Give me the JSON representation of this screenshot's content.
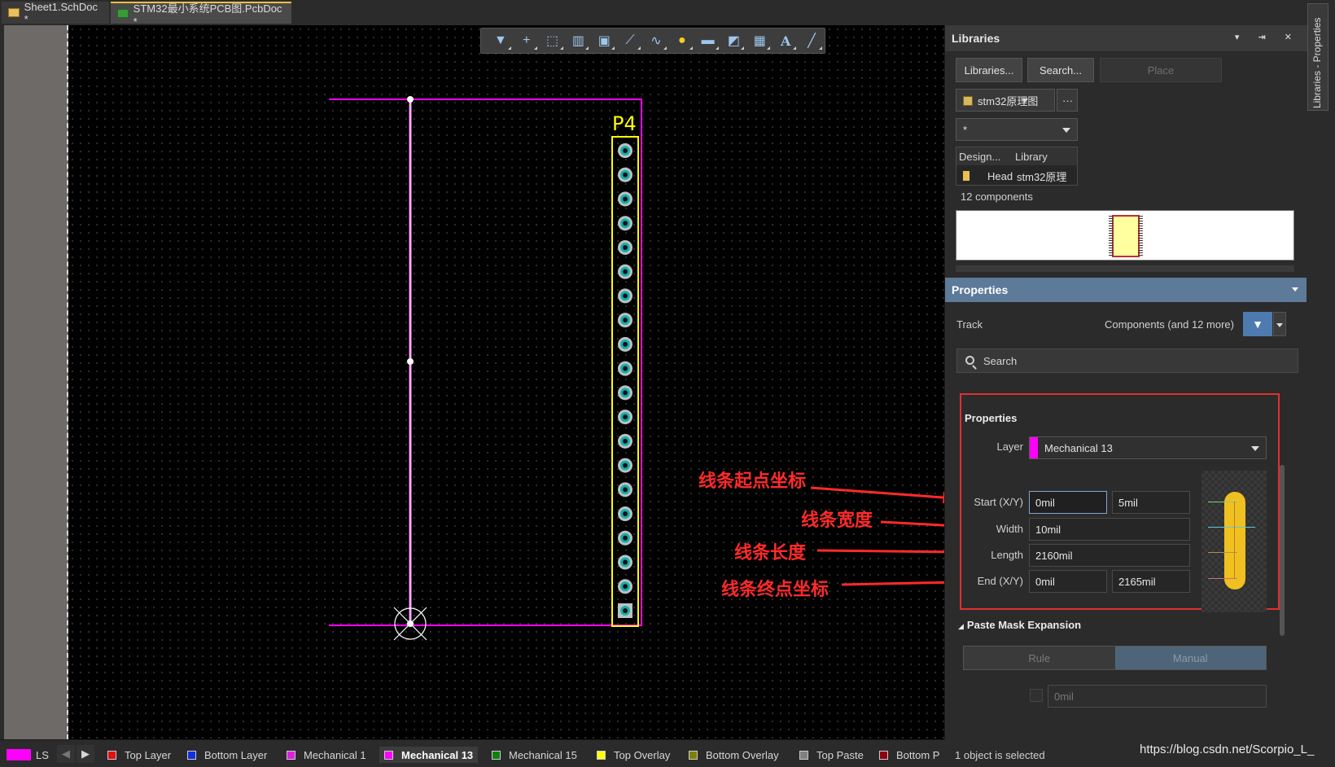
{
  "tabs": [
    {
      "label": "Sheet1.SchDoc *",
      "icon": "schematic-doc-icon"
    },
    {
      "label": "STM32最小系统PCB图.PcbDoc *",
      "icon": "pcb-doc-icon"
    }
  ],
  "toolbar": [
    "filter-icon",
    "crosshair-icon",
    "select-rect-icon",
    "bar-chart-icon",
    "component-icon",
    "route-icon",
    "diff-pair-icon",
    "pin-icon",
    "fill-icon",
    "region-icon",
    "graph-icon",
    "text-icon",
    "line-icon"
  ],
  "pcb": {
    "designator": "P4",
    "pad_count": 20
  },
  "libraries": {
    "title": "Libraries",
    "libraries_btn": "Libraries...",
    "search_btn": "Search...",
    "place_btn": "Place",
    "library_select": "stm32原理图",
    "more": "···",
    "filter_value": "*",
    "col_design": "Design...",
    "col_library": "Library",
    "row_design": "Head",
    "row_library": "stm32原理",
    "count": "12 components"
  },
  "properties": {
    "band_title": "Properties",
    "object_type": "Track",
    "filter_scope": "Components (and 12 more)",
    "search_placeholder": "Search",
    "section_title": "Properties",
    "layer_label": "Layer",
    "layer_value": "Mechanical 13",
    "layer_color": "#ff00ff",
    "start_label": "Start (X/Y)",
    "start_x": "0mil",
    "start_y": "5mil",
    "width_label": "Width",
    "width_value": "10mil",
    "length_label": "Length",
    "length_value": "2160mil",
    "end_label": "End (X/Y)",
    "end_x": "0mil",
    "end_y": "2165mil",
    "paste_title": "Paste Mask Expansion",
    "rule_label": "Rule",
    "manual_label": "Manual",
    "paste_value": "0mil"
  },
  "annotations": {
    "start": "线条起点坐标",
    "width": "线条宽度",
    "length": "线条长度",
    "end": "线条终点坐标"
  },
  "layers": [
    {
      "label": "LS",
      "color": "#ff00ff"
    },
    {
      "label": "Top Layer",
      "color": "#e01010"
    },
    {
      "label": "Bottom Layer",
      "color": "#1030e0"
    },
    {
      "label": "Mechanical 1",
      "color": "#e020e0"
    },
    {
      "label": "Mechanical 13",
      "color": "#ff00ff"
    },
    {
      "label": "Mechanical 15",
      "color": "#108010"
    },
    {
      "label": "Top Overlay",
      "color": "#ffff00"
    },
    {
      "label": "Bottom Overlay",
      "color": "#808000"
    },
    {
      "label": "Top Paste",
      "color": "#808080"
    },
    {
      "label": "Bottom P",
      "color": "#900010"
    }
  ],
  "status": {
    "selection": "1 object is selected"
  },
  "side_tab": "Libraries - Properties",
  "watermark": "https://blog.csdn.net/Scorpio_L_"
}
